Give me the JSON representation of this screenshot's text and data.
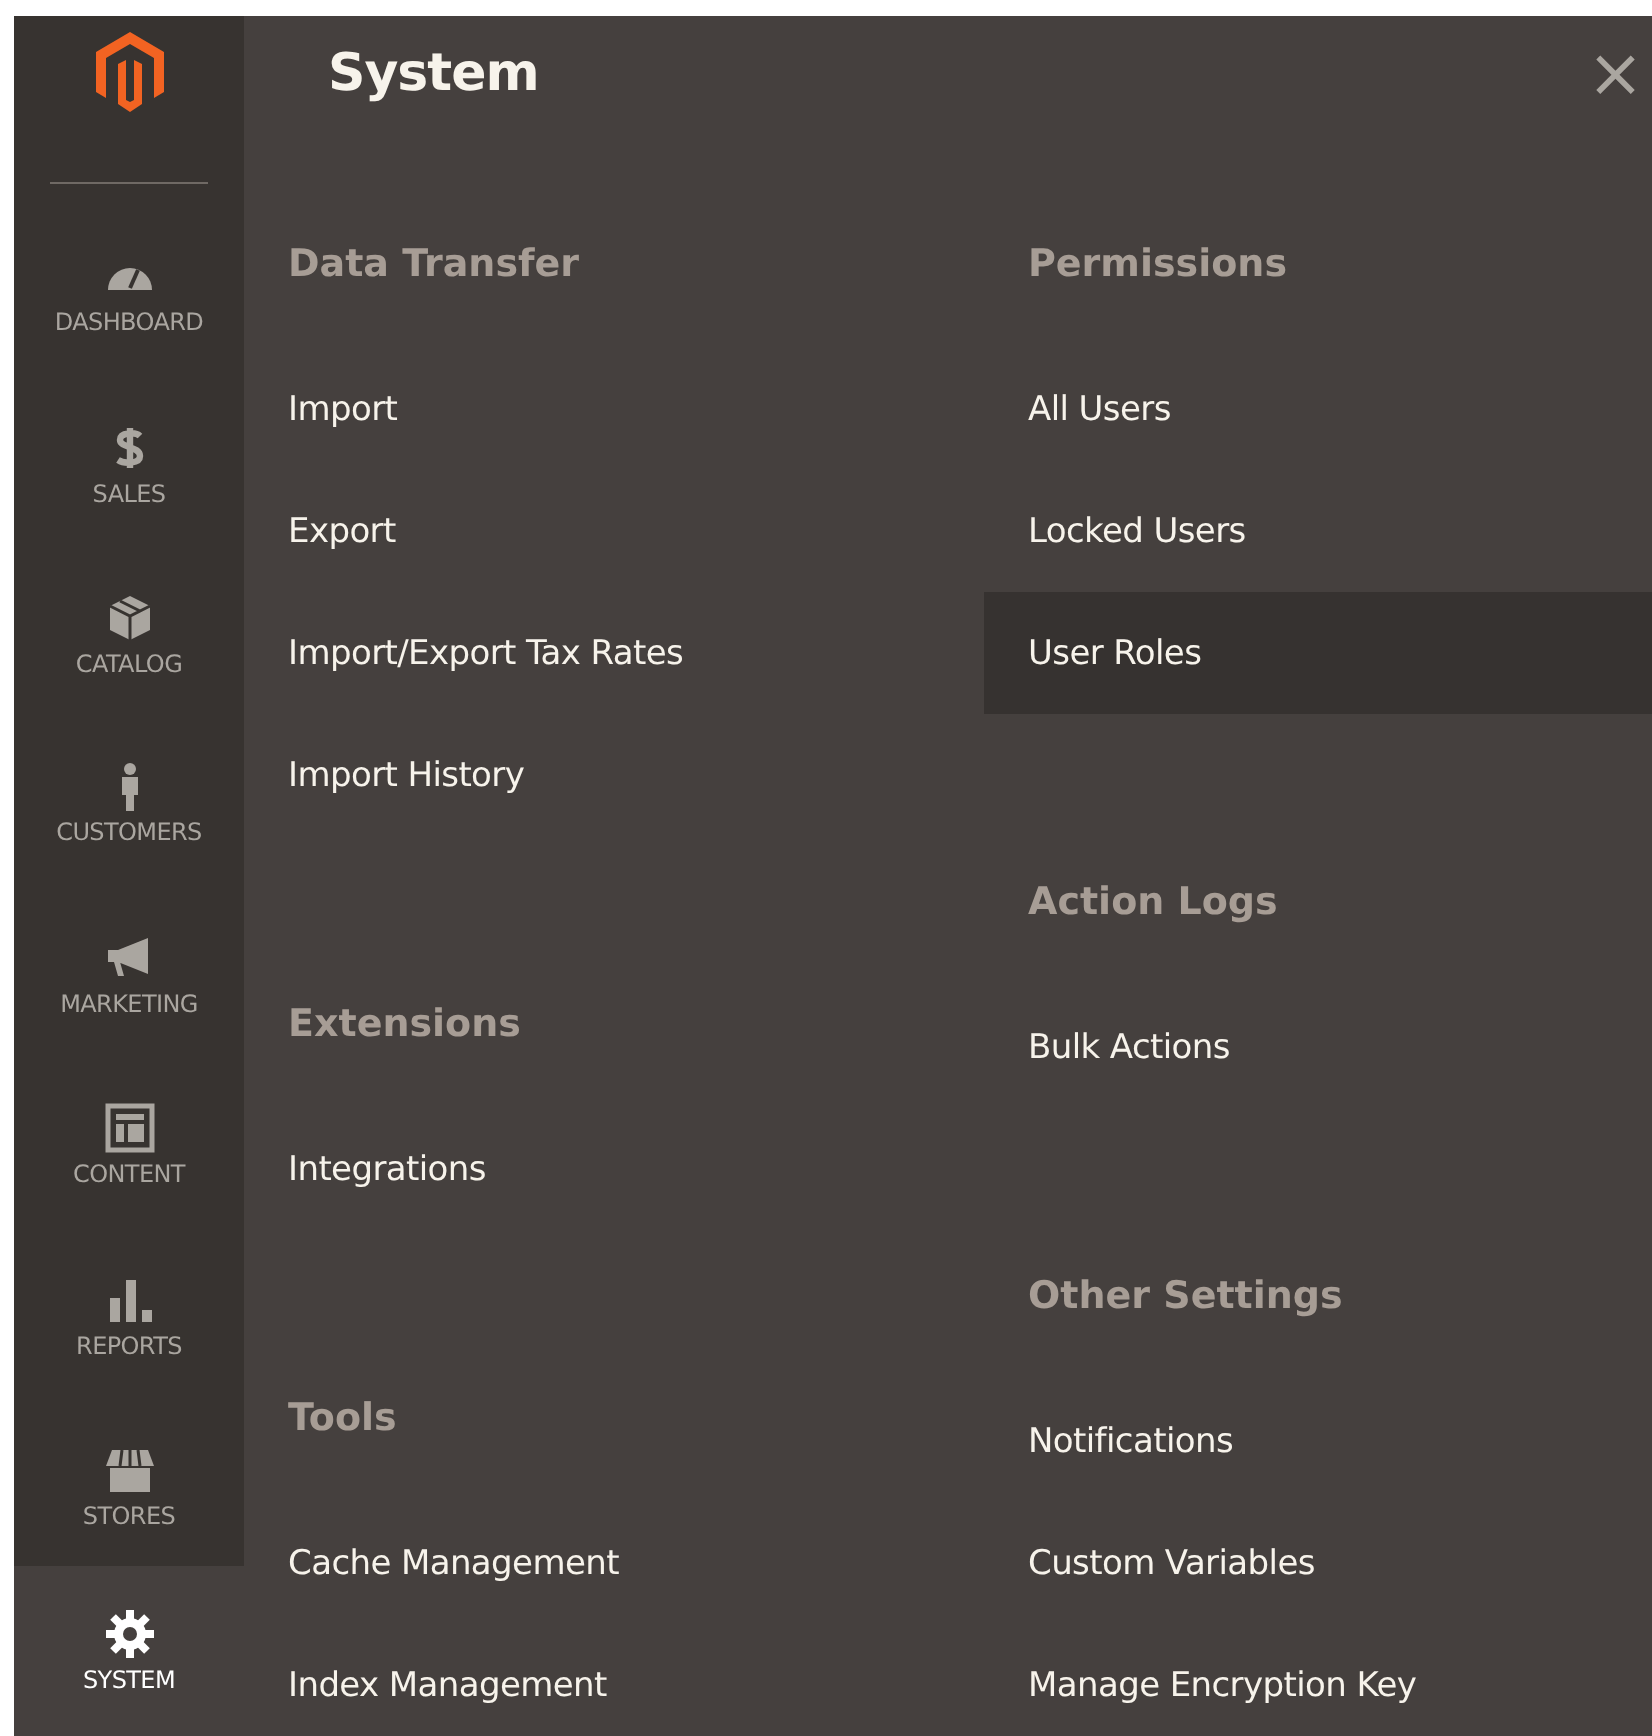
{
  "sidebar": {
    "items": [
      {
        "label": "DASHBOARD",
        "kind": "gauge",
        "selected": false
      },
      {
        "label": "SALES",
        "kind": "dollar",
        "selected": false
      },
      {
        "label": "CATALOG",
        "kind": "box",
        "selected": false
      },
      {
        "label": "CUSTOMERS",
        "kind": "person",
        "selected": false
      },
      {
        "label": "MARKETING",
        "kind": "megaphone",
        "selected": false
      },
      {
        "label": "CONTENT",
        "kind": "layout",
        "selected": false
      },
      {
        "label": "REPORTS",
        "kind": "bars",
        "selected": false
      },
      {
        "label": "STORES",
        "kind": "store",
        "selected": false
      },
      {
        "label": "SYSTEM",
        "kind": "gear",
        "selected": true
      }
    ]
  },
  "panel": {
    "title": "System",
    "close": "×",
    "columns": [
      [
        {
          "heading": "Data Transfer",
          "items": [
            {
              "label": "Import",
              "selected": false
            },
            {
              "label": "Export",
              "selected": false
            },
            {
              "label": "Import/Export Tax Rates",
              "selected": false
            },
            {
              "label": "Import History",
              "selected": false
            }
          ]
        },
        {
          "heading": "Extensions",
          "items": [
            {
              "label": "Integrations",
              "selected": false
            }
          ]
        },
        {
          "heading": "Tools",
          "items": [
            {
              "label": "Cache Management",
              "selected": false
            },
            {
              "label": "Index Management",
              "selected": false
            }
          ]
        }
      ],
      [
        {
          "heading": "Permissions",
          "items": [
            {
              "label": "All Users",
              "selected": false
            },
            {
              "label": "Locked Users",
              "selected": false
            },
            {
              "label": "User Roles",
              "selected": true
            }
          ]
        },
        {
          "heading": "Action Logs",
          "items": [
            {
              "label": "Bulk Actions",
              "selected": false
            }
          ]
        },
        {
          "heading": "Other Settings",
          "items": [
            {
              "label": "Notifications",
              "selected": false
            },
            {
              "label": "Custom Variables",
              "selected": false
            },
            {
              "label": "Manage Encryption Key",
              "selected": false
            }
          ]
        }
      ]
    ]
  }
}
